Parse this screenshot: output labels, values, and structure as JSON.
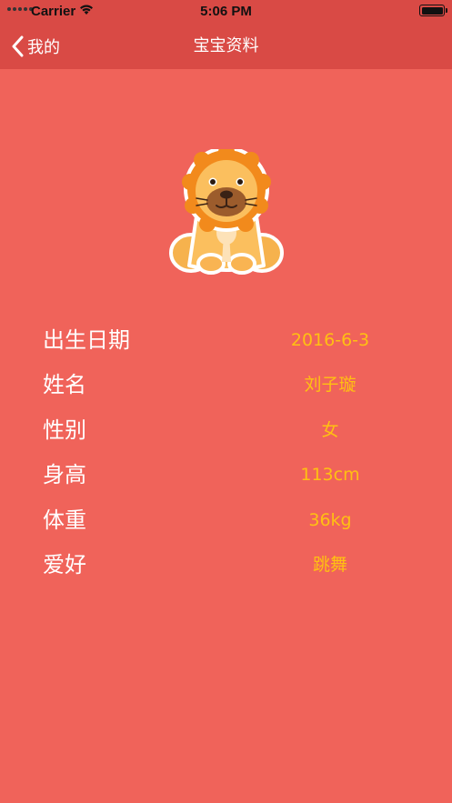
{
  "status_bar": {
    "carrier": "Carrier",
    "time": "5:06 PM"
  },
  "nav": {
    "back_label": "我的",
    "title": "宝宝资料"
  },
  "profile": {
    "avatar_icon": "lion-icon",
    "rows": [
      {
        "label": "出生日期",
        "value": "2016-6-3"
      },
      {
        "label": "姓名",
        "value": "刘子璇"
      },
      {
        "label": "性别",
        "value": "女"
      },
      {
        "label": "身高",
        "value": "113cm"
      },
      {
        "label": "体重",
        "value": "36kg"
      },
      {
        "label": "爱好",
        "value": "跳舞"
      }
    ]
  },
  "colors": {
    "background": "#f0635a",
    "nav_bar": "#d94a45",
    "label_text": "#ffffff",
    "value_text": "#ffc012"
  }
}
